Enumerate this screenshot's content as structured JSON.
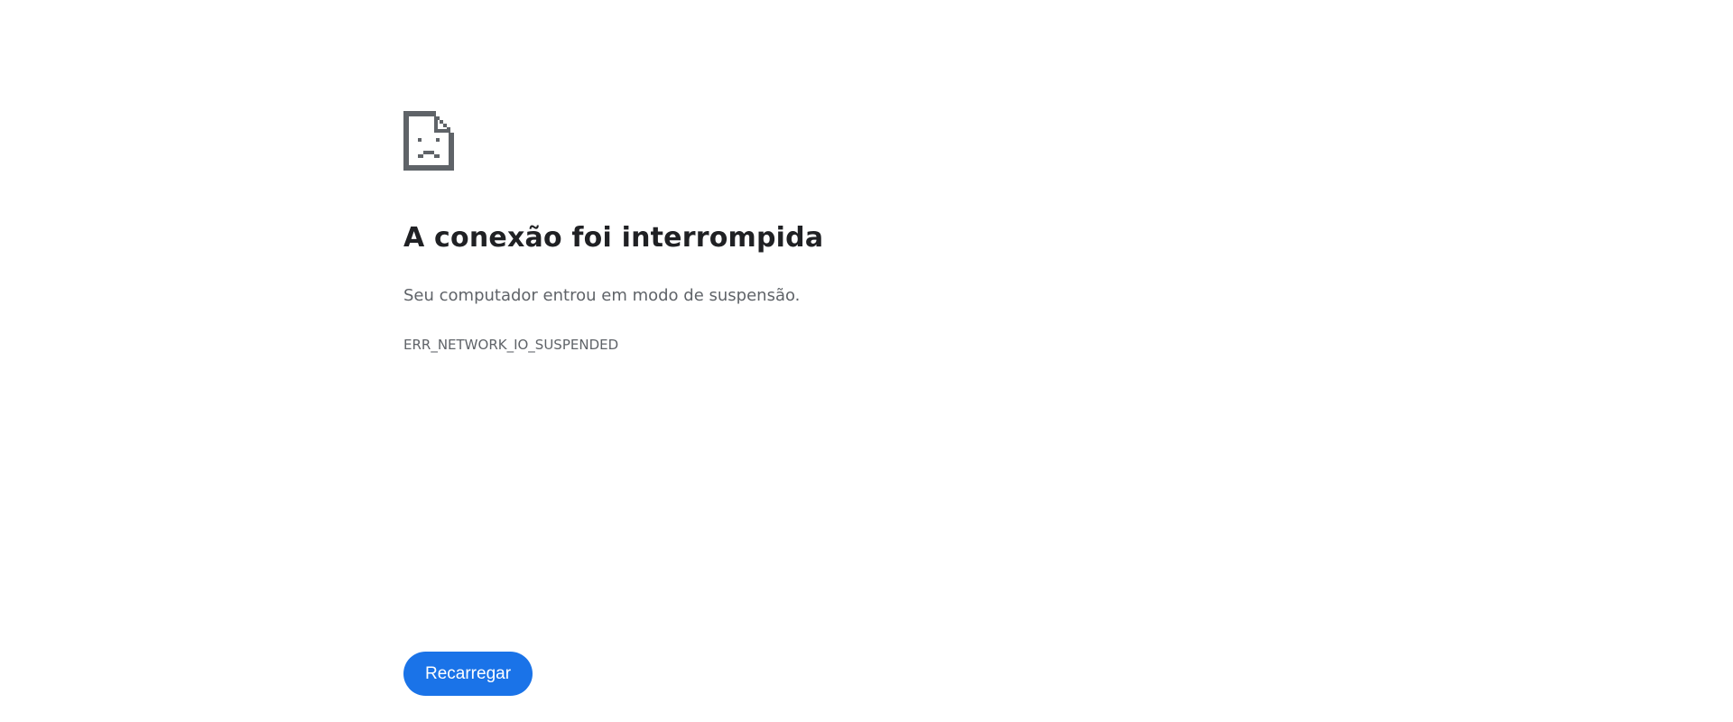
{
  "error_page": {
    "icon": "sad-page-icon",
    "title": "A conexão foi interrompida",
    "message": "Seu computador entrou em modo de suspensão.",
    "error_code": "ERR_NETWORK_IO_SUSPENDED",
    "reload_label": "Recarregar"
  },
  "colors": {
    "background": "#ffffff",
    "title": "#202124",
    "secondary_text": "#5f6368",
    "icon": "#5f6368",
    "button": "#1a73e8",
    "button_text": "#ffffff"
  }
}
